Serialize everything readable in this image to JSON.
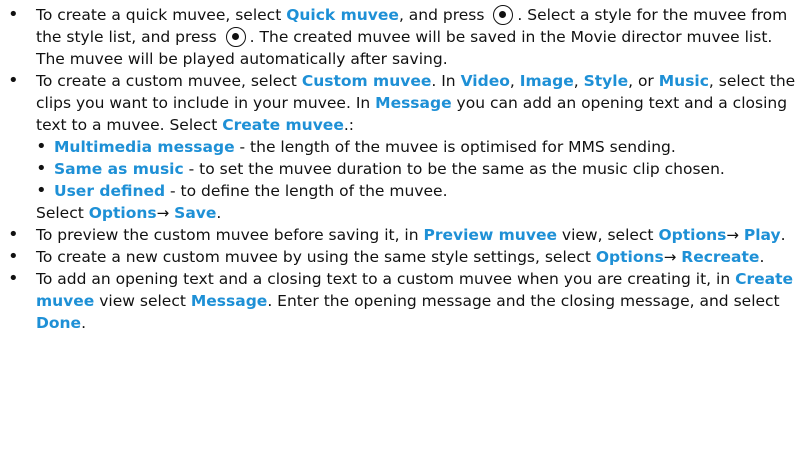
{
  "items": [
    {
      "a": "To create a quick muvee, select ",
      "b": "Quick muvee",
      "c": ", and press",
      "d": ". Select a style for the muvee from the style list, and press",
      "e": ". The created muvee will be saved in the Movie director muvee list. The muvee will be played automatically after saving.",
      "key_icon": "select-key-icon"
    },
    {
      "a": "To create a custom muvee, select ",
      "b": "Custom muvee",
      "c": ". In ",
      "d": "Video",
      "e": ", ",
      "f": "Image",
      "g": ", ",
      "h": "Style",
      "i": ", or ",
      "j": "Music",
      "k": ", select the clips you want to include in your muvee. In ",
      "l": "Message",
      "m": " you can add an opening text and a closing text to a muvee. Select ",
      "n": "Create muvee",
      "o": ".:",
      "sub": [
        {
          "term": "Multimedia message",
          "desc": " - the length of the muvee is optimised for MMS sending."
        },
        {
          "term": "Same as music",
          "desc": " - to set the muvee duration to be the same as the music clip chosen."
        },
        {
          "term": "User defined",
          "desc": " - to define the length of the muvee."
        }
      ],
      "final_a": "Select ",
      "final_b": "Options",
      "final_arrow": "→",
      "final_c": "Save",
      "final_d": "."
    },
    {
      "a": "To preview the custom muvee before saving it, in ",
      "b": "Preview muvee",
      "c": " view, select ",
      "d": "Options",
      "arrow": "→",
      "e": "Play",
      "f": "."
    },
    {
      "a": "To create a new custom muvee by using the same style settings, select ",
      "b": "Options",
      "arrow": "→",
      "c": "Recreate",
      "d": "."
    },
    {
      "a": "To add an opening text and a closing text to a custom muvee when you are creating it, in ",
      "b": "Create muvee",
      "c": " view select ",
      "d": "Message",
      "e": ". Enter the opening message and the closing message, and select ",
      "f": "Done",
      "g": "."
    }
  ],
  "bullet_symbol": "•",
  "colors": {
    "highlight": "#1e90d6",
    "text": "#111111",
    "background": "#ffffff"
  }
}
